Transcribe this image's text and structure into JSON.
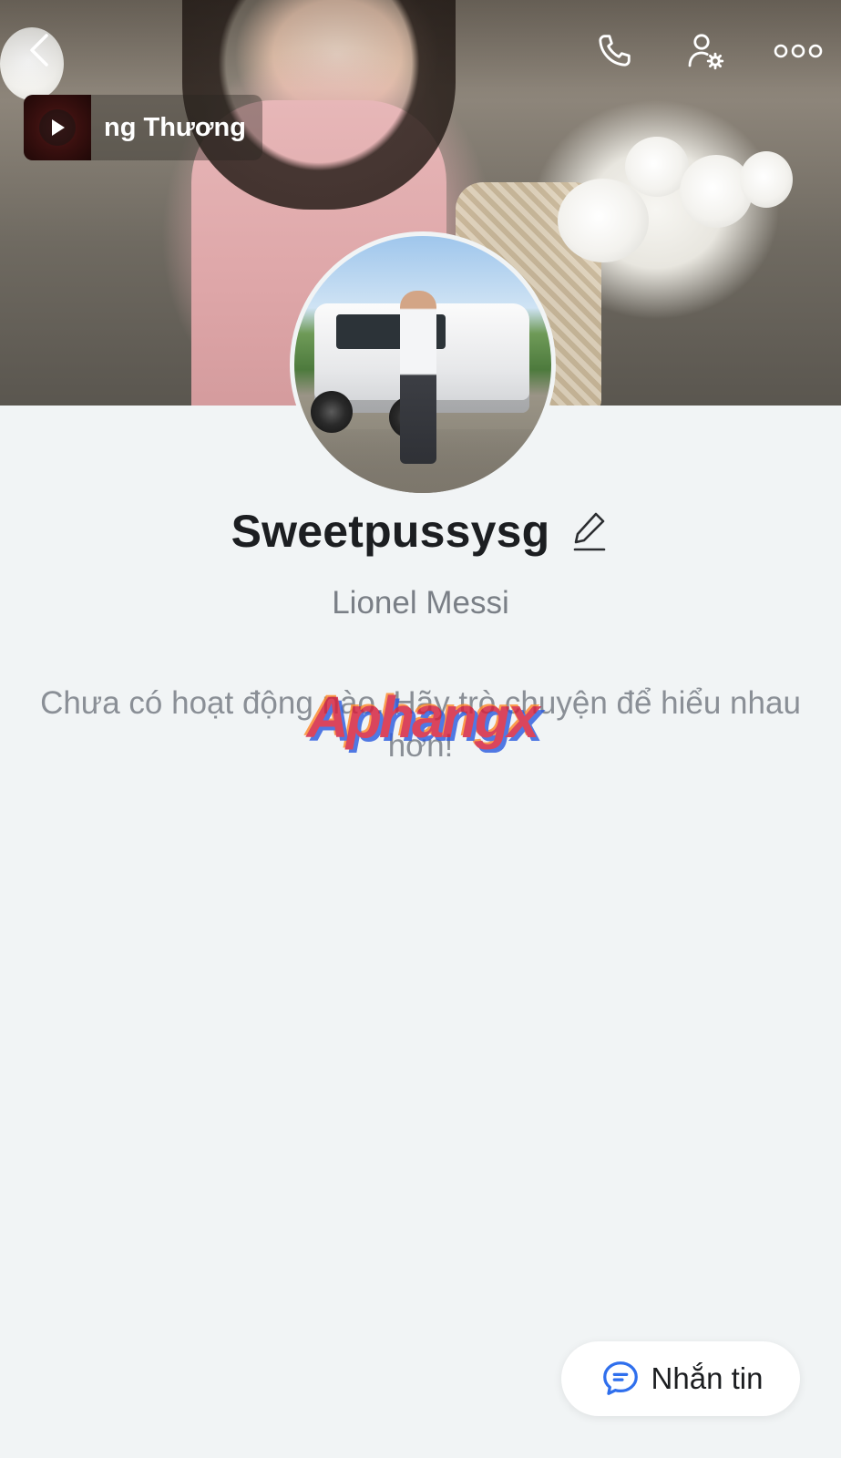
{
  "header": {
    "back_icon": "chevron-left-icon",
    "call_icon": "phone-icon",
    "settings_icon": "user-settings-icon",
    "more_icon": "more-horizontal-icon"
  },
  "music": {
    "title": "ng Thương",
    "play_icon": "play-icon"
  },
  "profile": {
    "name": "Sweetpussysg",
    "edit_icon": "pencil-icon",
    "subtitle": "Lionel Messi",
    "empty_note": "Chưa có hoạt động nào. Hãy trò chuyện để hiểu nhau hơn!"
  },
  "watermark": {
    "text": "Aphangx"
  },
  "actions": {
    "message_label": "Nhắn tin",
    "message_icon": "chat-bubble-icon"
  },
  "colors": {
    "background": "#f1f4f5",
    "accent_blue": "#2f6fed",
    "text_primary": "#1c1e21",
    "text_secondary": "#7a7f86"
  }
}
